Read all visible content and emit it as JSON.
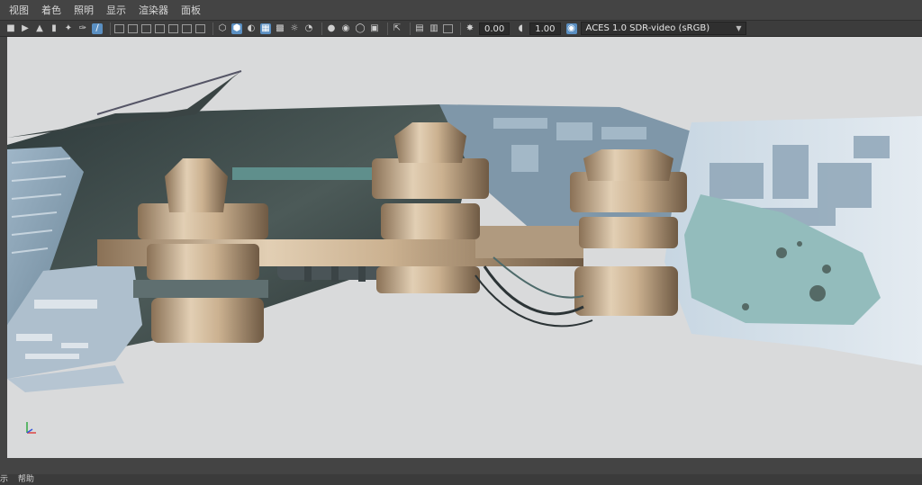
{
  "menu": {
    "items": [
      "视图",
      "着色",
      "照明",
      "显示",
      "渲染器",
      "面板"
    ]
  },
  "toolbar": {
    "exposure_value": "0.00",
    "gamma_value": "1.00",
    "color_space": "ACES 1.0 SDR-video (sRGB)",
    "icons": [
      "camera-icon",
      "camera-attr-icon",
      "bookmark-icon",
      "image-plane-icon",
      "2d-pan-icon",
      "grease-pencil-icon",
      "grid-icon",
      "film-gate-icon",
      "resolution-gate-icon",
      "gate-mask-icon",
      "field-chart-icon",
      "safe-action-icon",
      "safe-title-icon",
      "wireframe-icon",
      "smooth-shade-icon",
      "default-material-icon",
      "wireframe-on-shaded-icon",
      "textured-icon",
      "use-all-lights-icon",
      "shadows-icon",
      "screen-space-ao-icon",
      "motion-blur-icon",
      "multisample-aa-icon",
      "depth-of-field-icon",
      "isolate-select-icon",
      "xray-icon",
      "xray-active-icon",
      "xray-joints-icon",
      "exposure-icon",
      "gamma-icon",
      "color-management-icon"
    ]
  },
  "status": {
    "left_text": "示",
    "help_label": "帮助"
  },
  "colors": {
    "viewport_bg": "#d9dadb",
    "ui_bg": "#444444",
    "toolbar_bg": "#3c3c3c",
    "accent": "#5a8fc2"
  }
}
